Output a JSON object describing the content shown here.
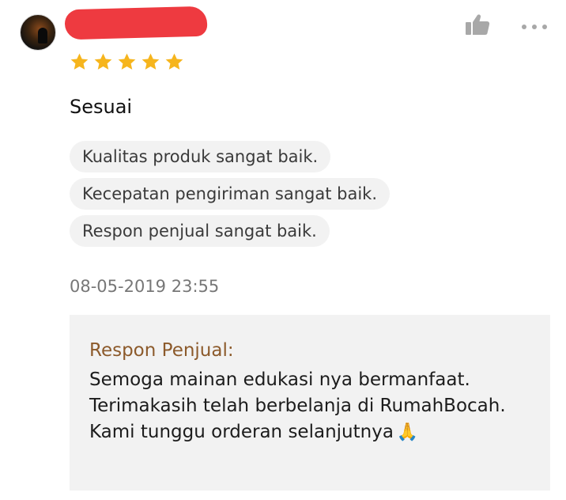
{
  "reviewer": {
    "avatar_alt": "avatar",
    "name_hidden": true
  },
  "rating": {
    "stars": 5,
    "max": 5,
    "star_color": "#f6b51d"
  },
  "review": {
    "text": "Sesuai",
    "tags": [
      "Kualitas produk sangat baik.",
      "Kecepatan pengiriman sangat baik.",
      "Respon penjual sangat baik."
    ],
    "timestamp": "08-05-2019 23:55"
  },
  "seller_response": {
    "label": "Respon Penjual:",
    "message": "Semoga mainan edukasi nya bermanfaat. Terimakasih telah berbelanja di RumahBocah. Kami tunggu orderan selanjutnya",
    "emoji": "🙏"
  },
  "actions": {
    "like_icon": "thumbs-up-icon",
    "more_icon": "more-options-icon",
    "icon_color": "#a8a8a8"
  }
}
